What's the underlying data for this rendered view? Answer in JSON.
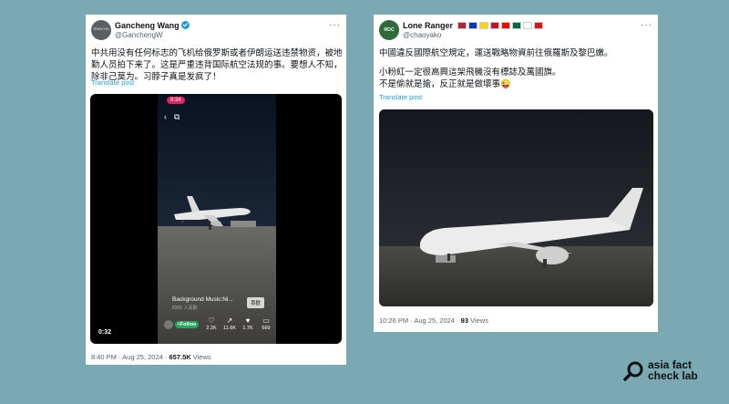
{
  "tweet1": {
    "user_name": "Gancheng Wang",
    "handle": "@GanchengW",
    "avatar_text": "RNNKHN",
    "more": "···",
    "text": "中共用没有任何标志的飞机给俄罗斯或者伊朗运送违禁物资，被地勤人员拍下来了。这是严重违背国际航空法规的事。要想人不知，除非己莫为。习脖子真是发疯了！",
    "translate": "Translate post",
    "video": {
      "time_pill": "8:34",
      "bgm_title": "Background Music:Ni...",
      "bgm_sub": "8305 人喜歡",
      "bgm_button": "喜歡",
      "follow_label": "+Follow",
      "stats": [
        {
          "icon": "like-icon",
          "glyph": "♡",
          "value": "2.2K"
        },
        {
          "icon": "share-icon",
          "glyph": "↗",
          "value": "11.6K"
        },
        {
          "icon": "heart-icon",
          "glyph": "♥",
          "value": "1.7K"
        },
        {
          "icon": "comment-icon",
          "glyph": "▭",
          "value": "669"
        }
      ],
      "duration": "0:32"
    },
    "timestamp": "8:40 PM · Aug 25, 2024 · ",
    "views_count": "657.5K",
    "views_label": " Views"
  },
  "tweet2": {
    "user_name": "Lone Ranger",
    "handle": "@chaoyako",
    "avatar_text": "ROC",
    "more": "···",
    "flag_colors": [
      "#b22234",
      "#0038b8",
      "#ffd500",
      "#c8102e",
      "#fe0000",
      "#006a44",
      "#ffffff",
      "#d7141a"
    ],
    "text_line1": "中國違反國際航空規定，運送戰略物資前往俄羅斯及黎巴嫩。",
    "text_line2": "小粉紅一定很高興這架飛機沒有標誌及萬國旗。",
    "text_line3": "不是偷就是搶，反正就是做壞事😜",
    "translate": "Translate post",
    "timestamp": "10:26 PM · Aug 25, 2024 · ",
    "views_count": "93",
    "views_label": " Views"
  },
  "logo": {
    "line1": "asia fact",
    "line2": "check lab"
  },
  "colors": {
    "background": "#7aa9b4",
    "link": "#1d9bf0",
    "follow": "#26a55d",
    "time_pill": "#e0245e"
  }
}
